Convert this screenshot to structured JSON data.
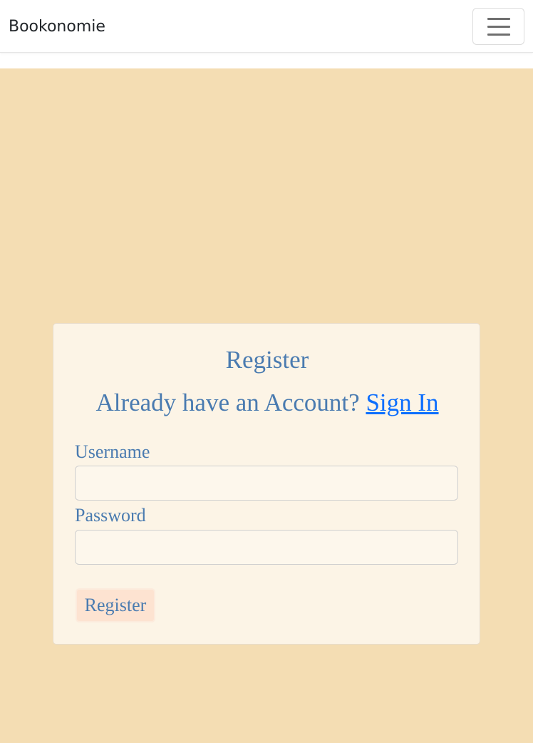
{
  "navbar": {
    "brand": "Bookonomie",
    "toggler_icon": "hamburger-menu-icon"
  },
  "register_card": {
    "title": "Register",
    "subtitle_prefix": "Already have an Account?",
    "sign_in_link": "Sign In",
    "username_label": "Username",
    "username_value": "",
    "password_label": "Password",
    "password_value": "",
    "submit_label": "Register"
  },
  "colors": {
    "page_background": "#f4ddb3",
    "card_background": "#fcf4e6",
    "text_accent": "#4a7bb0",
    "link": "#0d6efd",
    "button_background": "#fde3d1"
  }
}
